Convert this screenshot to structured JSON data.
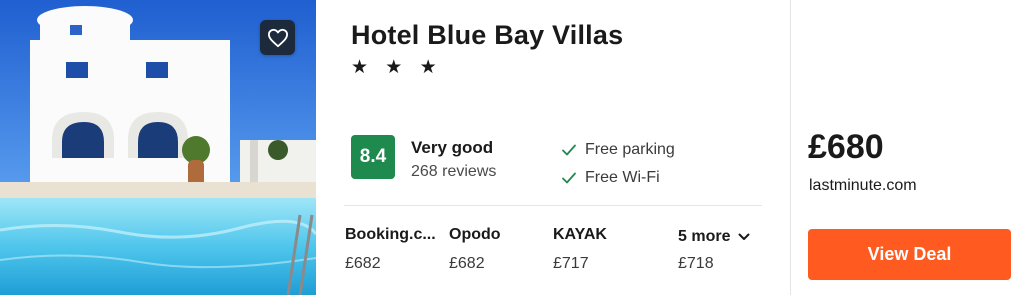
{
  "hotel": {
    "name": "Hotel Blue Bay Villas",
    "stars_text": "★ ★ ★",
    "star_count": 3
  },
  "rating": {
    "score": "8.4",
    "label": "Very good",
    "reviews": "268 reviews",
    "badge_color": "#1e8a4d"
  },
  "amenities": [
    {
      "label": "Free parking",
      "icon": "check-icon"
    },
    {
      "label": "Free Wi-Fi",
      "icon": "check-icon"
    }
  ],
  "providers": [
    {
      "name": "Booking.c...",
      "price": "£682"
    },
    {
      "name": "Opodo",
      "price": "£682"
    },
    {
      "name": "KAYAK",
      "price": "£717"
    }
  ],
  "more_providers": {
    "label": "5 more",
    "price": "£718",
    "icon": "chevron-down-icon"
  },
  "best_deal": {
    "price": "£680",
    "site": "lastminute.com",
    "button_label": "View Deal",
    "button_color": "#ff5a1f"
  },
  "favorite": {
    "icon": "heart-icon"
  }
}
